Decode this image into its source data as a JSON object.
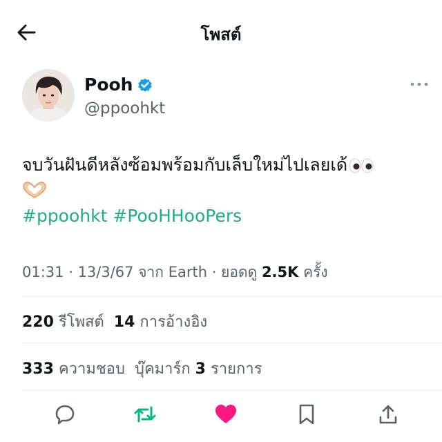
{
  "header": {
    "title": "โพสต์"
  },
  "author": {
    "display_name": "Pooh",
    "handle": "@ppoohkt"
  },
  "tweet": {
    "text": "จบวันฝันดีหลังซ้อมพร้อมกับเล็บใหม่ไปเลยเด้",
    "hashtags": [
      "#ppoohkt",
      "#PooHHooPers"
    ]
  },
  "meta": {
    "time": "01:31",
    "sep1": " · ",
    "date": "13/3/67",
    "source_prefix": " จาก ",
    "source": "Earth",
    "sep2": " · ",
    "views_label": "ยอดดู ",
    "views": "2.5K",
    "views_suffix": " ครั้ง"
  },
  "stats": {
    "reposts_count": "220",
    "reposts_label": "รีโพสต์",
    "quotes_count": "14",
    "quotes_label": "การอ้างอิง",
    "likes_count": "333",
    "likes_label": "ความชอบ",
    "bookmarks_label": "บุ๊คมาร์ก",
    "bookmarks_count": "3",
    "bookmarks_suffix": "รายการ"
  },
  "colors": {
    "accent_green": "#1dae87",
    "like_pink": "#f91880",
    "verified_blue": "#1d9bf0",
    "secondary_text": "#536471"
  },
  "icons": [
    "back-arrow-icon",
    "verified-badge-icon",
    "more-icon",
    "reply-icon",
    "repost-icon",
    "like-icon",
    "bookmark-icon",
    "share-icon"
  ]
}
